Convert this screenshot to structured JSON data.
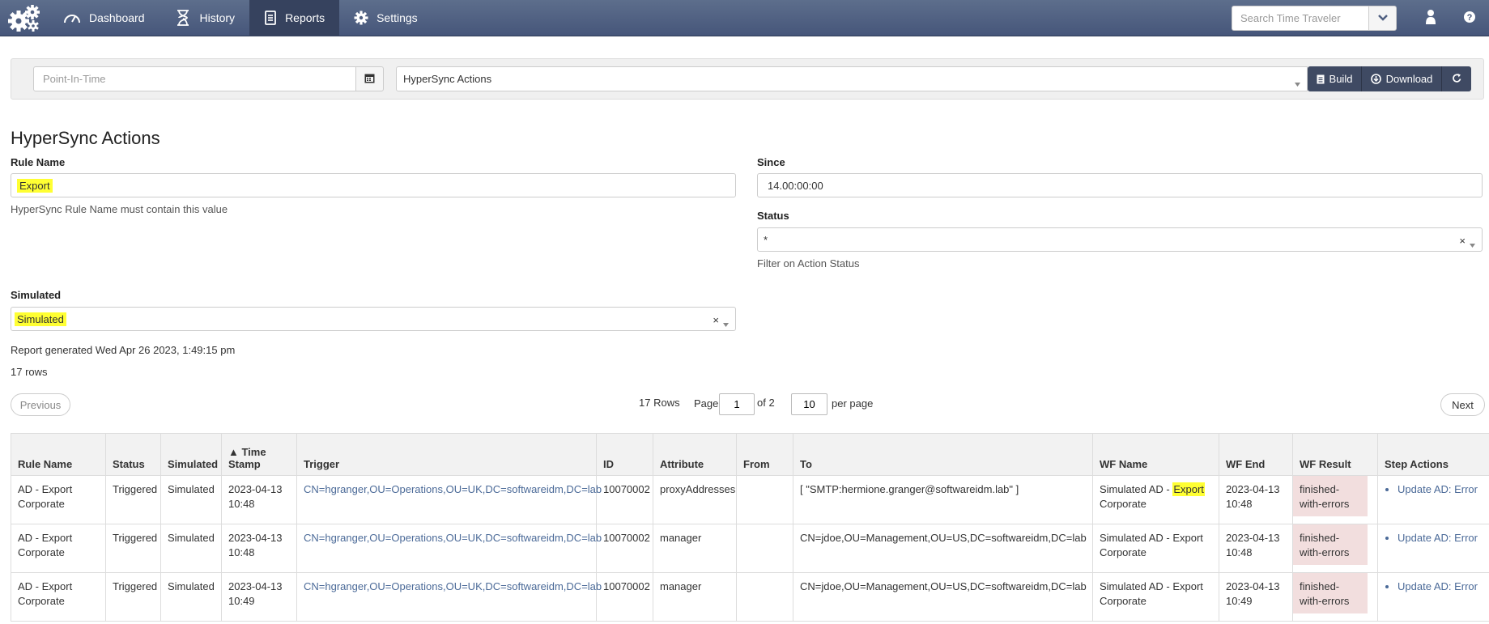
{
  "nav": {
    "items": [
      {
        "label": "Dashboard",
        "icon": "dashboard-gauge-icon"
      },
      {
        "label": "History",
        "icon": "hourglass-icon"
      },
      {
        "label": "Reports",
        "icon": "report-book-icon"
      },
      {
        "label": "Settings",
        "icon": "gear-icon"
      }
    ],
    "search_placeholder": "Search Time Traveler"
  },
  "toolbar": {
    "point_in_time_placeholder": "Point-In-Time",
    "report_selected": "HyperSync Actions",
    "build_label": "Build",
    "download_label": "Download"
  },
  "report": {
    "title": "HyperSync Actions",
    "rule_name_label": "Rule Name",
    "rule_name_value": "Export",
    "rule_name_help": "HyperSync Rule Name must contain this value",
    "since_label": "Since",
    "since_value": "14.00:00:00",
    "status_label": "Status",
    "status_value": "*",
    "status_help": "Filter on Action Status",
    "simulated_label": "Simulated",
    "simulated_value": "Simulated",
    "generated_text": "Report generated Wed Apr 26 2023, 1:49:15 pm",
    "rows_text": "17 rows"
  },
  "pager": {
    "previous_label": "Previous",
    "next_label": "Next",
    "rows_count_text": "17 Rows",
    "page_label": "Page",
    "page_value": "1",
    "of_text": "of 2",
    "per_page_value": "10",
    "per_page_label": "per page"
  },
  "table": {
    "columns": [
      "Rule Name",
      "Status",
      "Simulated",
      "▲ Time Stamp",
      "Trigger",
      "ID",
      "Attribute",
      "From",
      "To",
      "WF Name",
      "WF End",
      "WF Result",
      "Step Actions"
    ],
    "rows": [
      {
        "rule_name": "AD - Export Corporate",
        "status": "Triggered",
        "simulated": "Simulated",
        "time_stamp": "2023-04-13 10:48",
        "trigger": "CN=hgranger,OU=Operations,OU=UK,DC=softwareidm,DC=lab",
        "id": "10070002",
        "attribute": "proxyAddresses",
        "from": "",
        "to": "[ \"SMTP:hermione.granger@softwareidm.lab\" ]",
        "wf_name_prefix": "Simulated AD - ",
        "wf_name_highlight": "Export",
        "wf_name_suffix": " Corporate",
        "wf_end": "2023-04-13 10:48",
        "wf_result": "finished-with-errors",
        "step_action": "Update AD: Error"
      },
      {
        "rule_name": "AD - Export Corporate",
        "status": "Triggered",
        "simulated": "Simulated",
        "time_stamp": "2023-04-13 10:48",
        "trigger": "CN=hgranger,OU=Operations,OU=UK,DC=softwareidm,DC=lab",
        "id": "10070002",
        "attribute": "manager",
        "from": "",
        "to": "CN=jdoe,OU=Management,OU=US,DC=softwareidm,DC=lab",
        "wf_name_prefix": "Simulated AD - Export Corporate",
        "wf_name_highlight": "",
        "wf_name_suffix": "",
        "wf_end": "2023-04-13 10:48",
        "wf_result": "finished-with-errors",
        "step_action": "Update AD: Error"
      },
      {
        "rule_name": "AD - Export Corporate",
        "status": "Triggered",
        "simulated": "Simulated",
        "time_stamp": "2023-04-13 10:49",
        "trigger": "CN=hgranger,OU=Operations,OU=UK,DC=softwareidm,DC=lab",
        "id": "10070002",
        "attribute": "manager",
        "from": "",
        "to": "CN=jdoe,OU=Management,OU=US,DC=softwareidm,DC=lab",
        "wf_name_prefix": "Simulated AD - Export Corporate",
        "wf_name_highlight": "",
        "wf_name_suffix": "",
        "wf_end": "2023-04-13 10:49",
        "wf_result": "finished-with-errors",
        "step_action": "Update AD: Error"
      }
    ]
  },
  "colors": {
    "navbar": "#4f5f80",
    "highlight": "#ffff33",
    "error_cell": "#f2dede",
    "link": "#4b6a98"
  }
}
